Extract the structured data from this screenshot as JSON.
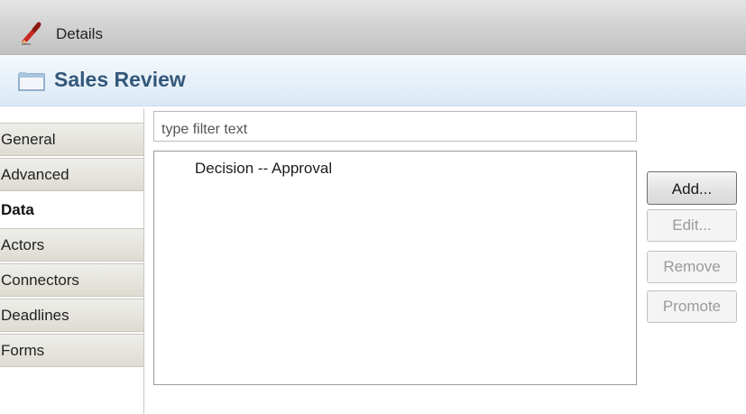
{
  "view": {
    "title": "Details",
    "icon": "pencil-icon"
  },
  "header": {
    "title": "Sales Review",
    "icon": "folder-icon"
  },
  "tabs": [
    {
      "label": "General",
      "active": false
    },
    {
      "label": "Advanced",
      "active": false
    },
    {
      "label": "Data",
      "active": true
    },
    {
      "label": "Actors",
      "active": false
    },
    {
      "label": "Connectors",
      "active": false
    },
    {
      "label": "Deadlines",
      "active": false
    },
    {
      "label": "Forms",
      "active": false
    }
  ],
  "filter": {
    "placeholder": "type filter text",
    "value": ""
  },
  "list": {
    "items": [
      "Decision -- Approval"
    ]
  },
  "buttons": {
    "add": {
      "label": "Add...",
      "enabled": true
    },
    "edit": {
      "label": "Edit...",
      "enabled": false
    },
    "remove": {
      "label": "Remove",
      "enabled": false
    },
    "promote": {
      "label": "Promote",
      "enabled": false
    }
  },
  "colors": {
    "header_text": "#34587a",
    "header_bg": "#dbe9f5",
    "tab_bg": "#dedbd2",
    "disabled_text": "#9a9a9a"
  }
}
